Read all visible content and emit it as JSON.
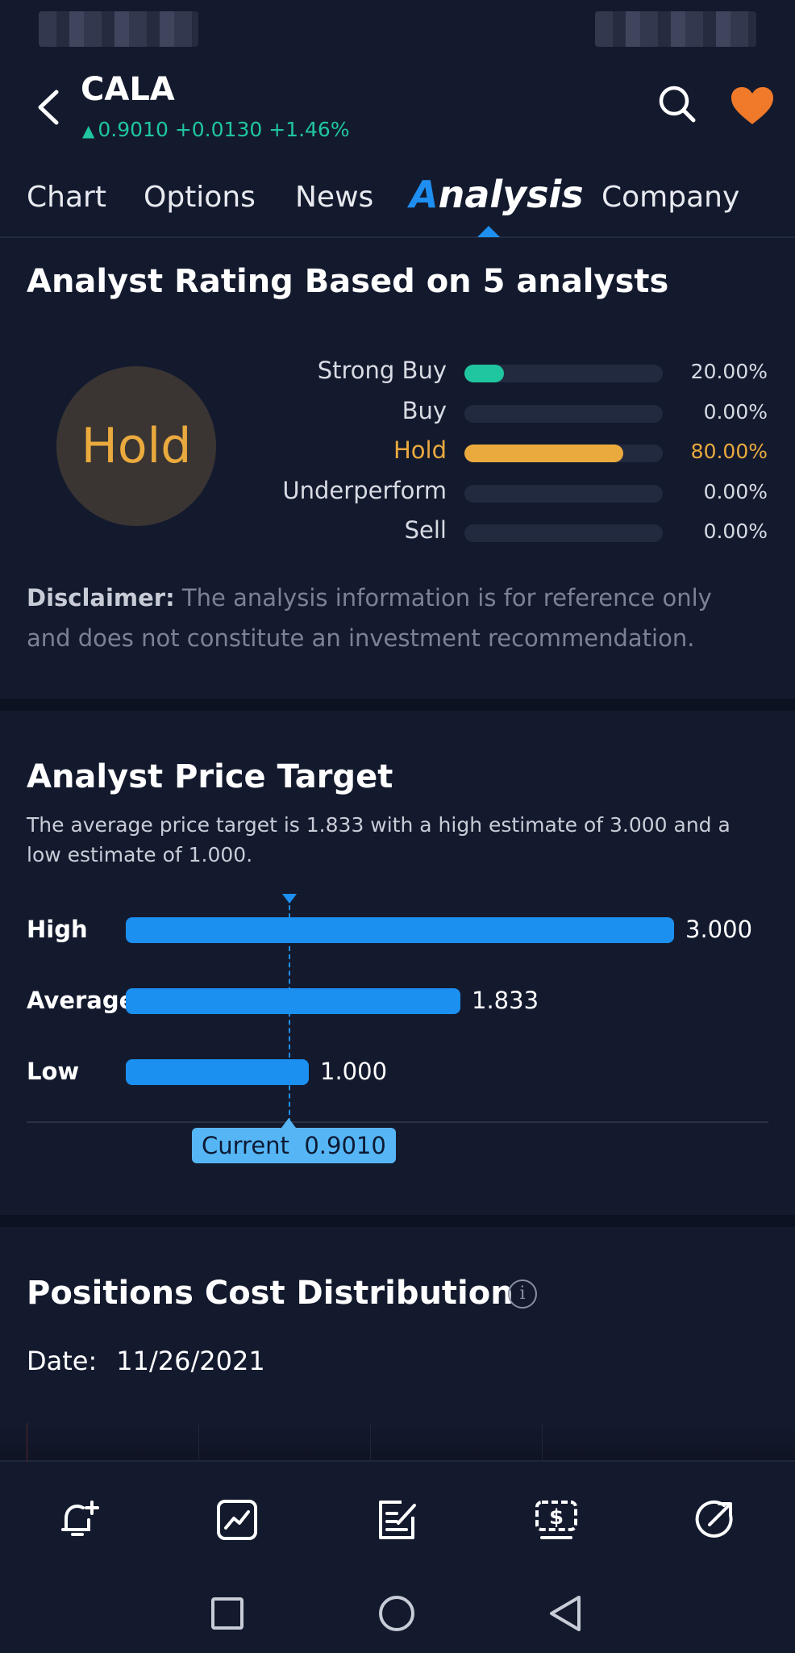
{
  "header": {
    "ticker": "CALA",
    "price": "0.9010",
    "change": "+0.0130",
    "change_pct": "+1.46%",
    "price_color": "#1fc6a0",
    "favorite_color": "#f07a2a"
  },
  "tabs": [
    {
      "label": "Chart"
    },
    {
      "label": "Options"
    },
    {
      "label": "News"
    },
    {
      "label_first": "A",
      "label_rest": "nalysis",
      "active": true
    },
    {
      "label": "Company"
    }
  ],
  "analyst_rating": {
    "title": "Analyst Rating  Based on 5 analysts",
    "consensus": "Hold",
    "rows": [
      {
        "label": "Strong Buy",
        "pct": "20.00%",
        "value": 0.2,
        "color": "#1fc6a0"
      },
      {
        "label": "Buy",
        "pct": "0.00%",
        "value": 0.0,
        "color": "#1fc6a0"
      },
      {
        "label": "Hold",
        "pct": "80.00%",
        "value": 0.8,
        "color": "#eaaa3e"
      },
      {
        "label": "Underperform",
        "pct": "0.00%",
        "value": 0.0,
        "color": "#e8474f"
      },
      {
        "label": "Sell",
        "pct": "0.00%",
        "value": 0.0,
        "color": "#e8474f"
      }
    ],
    "disclaimer_label": "Disclaimer:",
    "disclaimer_text": " The analysis information is for reference only and does not constitute an investment recommendation."
  },
  "price_target": {
    "title": "Analyst Price Target",
    "description": "The average price target is 1.833 with a high estimate of 3.000 and a low estimate of 1.000.",
    "rows": [
      {
        "label": "High",
        "value": "3.000"
      },
      {
        "label": "Average",
        "value": "1.833"
      },
      {
        "label": "Low",
        "value": "1.000"
      }
    ],
    "current_label": "Current",
    "current_value": "0.9010",
    "bar_color": "#1b90f0"
  },
  "chart_data": {
    "type": "bar",
    "title": "Analyst Price Target",
    "categories": [
      "High",
      "Average",
      "Low"
    ],
    "values": [
      3.0,
      1.833,
      1.0
    ],
    "reference_line": {
      "label": "Current",
      "value": 0.901
    },
    "xlim": [
      0,
      3.0
    ]
  },
  "positions": {
    "title": "Positions Cost Distribution",
    "date_label": "Date:",
    "date_value": "11/26/2021"
  },
  "bottom_actions": [
    {
      "icon": "bell-plus-icon"
    },
    {
      "icon": "chart-trend-icon"
    },
    {
      "icon": "edit-note-icon"
    },
    {
      "icon": "dollar-trade-icon"
    },
    {
      "icon": "share-icon"
    }
  ],
  "nav": [
    {
      "icon": "square-icon"
    },
    {
      "icon": "circle-icon"
    },
    {
      "icon": "triangle-back-icon"
    }
  ]
}
